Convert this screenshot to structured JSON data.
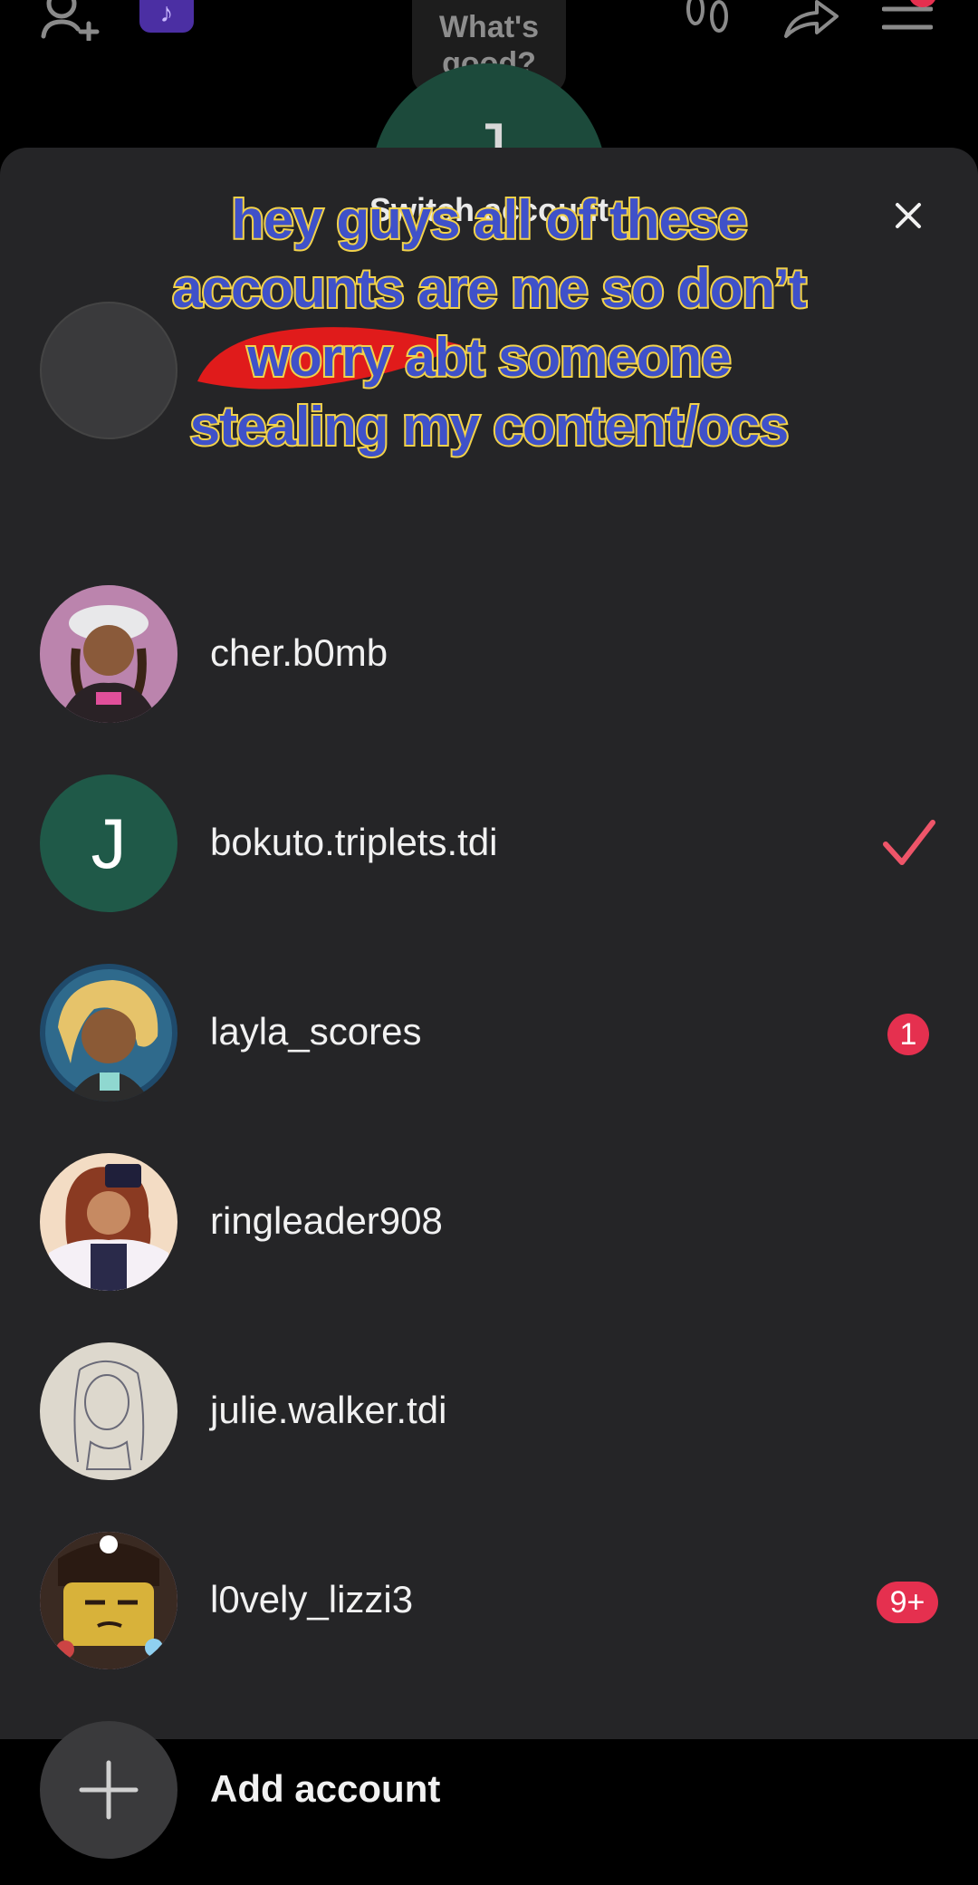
{
  "profile_bubble": {
    "text_line1": "What's",
    "text_line2": "good?"
  },
  "profile_avatar_letter": "J",
  "sheet": {
    "title": "Switch account",
    "close_icon": "close-icon"
  },
  "caption": {
    "line1": "hey guys all of these",
    "line2": "accounts are me so don’t",
    "line3": "worry abt someone",
    "line4": "stealing my content/ocs"
  },
  "accounts": [
    {
      "username": "cher.b0mb",
      "avatar": "drawn-portrait-cap",
      "status": ""
    },
    {
      "username": "bokuto.triplets.tdi",
      "avatar_letter": "J",
      "status": "selected"
    },
    {
      "username": "layla_scores",
      "avatar": "drawn-portrait-blonde",
      "badge": "1"
    },
    {
      "username": "ringleader908",
      "avatar": "drawn-portrait-tophat",
      "status": ""
    },
    {
      "username": "julie.walker.tdi",
      "avatar": "sketch-portrait",
      "status": ""
    },
    {
      "username": "l0vely_lizzi3",
      "avatar": "lego-figure-portrait",
      "badge": "9+"
    }
  ],
  "add_account": {
    "label": "Add account",
    "icon": "plus-icon"
  },
  "colors": {
    "sheet_bg": "#252527",
    "check": "#ee5569",
    "badge": "#e5304f",
    "caption_fill": "#3f51c9",
    "caption_stroke": "#f2d24b"
  }
}
